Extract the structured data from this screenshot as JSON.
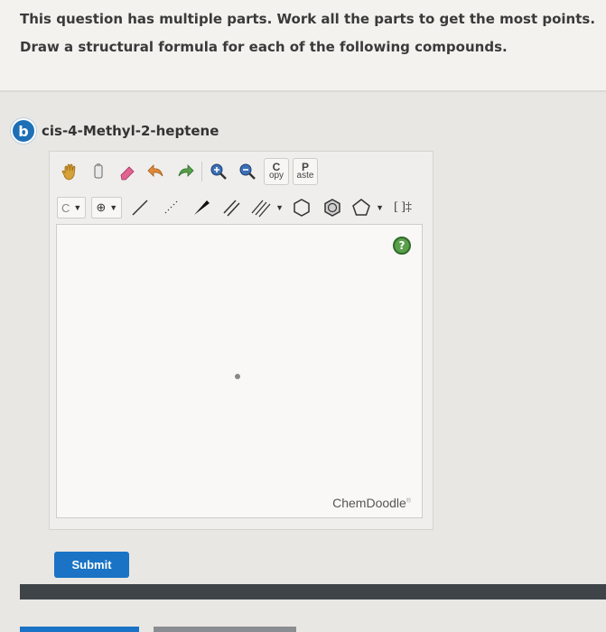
{
  "instructions": {
    "line1": "This question has multiple parts. Work all the parts to get the most points.",
    "line2": "Draw a structural formula for each of the following compounds."
  },
  "part": {
    "badge": "b",
    "label": "cis-4-Methyl-2-heptene"
  },
  "toolbar": {
    "copy_top": "C",
    "copy_bottom": "opy",
    "paste_top": "P",
    "paste_bottom": "aste",
    "atom_selector": "C",
    "charge_symbol": "⊕",
    "bracket_tool": "[ ]‡"
  },
  "editor": {
    "help_symbol": "?",
    "brand": "ChemDoodle",
    "brand_mark": "®"
  },
  "submit": {
    "label": "Submit"
  },
  "colors": {
    "accent": "#1a73c4",
    "badge": "#1d70b6",
    "help_green": "#5aa04a"
  }
}
